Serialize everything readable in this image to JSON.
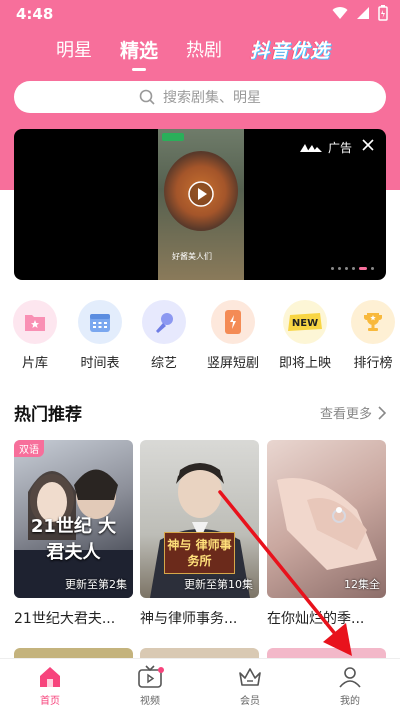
{
  "status": {
    "time": "4:48"
  },
  "top_tabs": [
    {
      "label": "明星"
    },
    {
      "label": "精选",
      "active": true
    },
    {
      "label": "热剧"
    }
  ],
  "promo_label": "抖音优选",
  "search": {
    "placeholder": "搜索剧集、明星"
  },
  "banner": {
    "ad_label": "广告",
    "thumb_caption": "好酱美人们"
  },
  "categories": [
    {
      "label": "片库",
      "icon": "film-library-icon",
      "color": "#f990b4"
    },
    {
      "label": "时间表",
      "icon": "calendar-icon",
      "color": "#7aa7ef"
    },
    {
      "label": "综艺",
      "icon": "microphone-icon",
      "color": "#8c98f1"
    },
    {
      "label": "竖屏短剧",
      "icon": "phone-icon",
      "color": "#f48b55"
    },
    {
      "label": "即将上映",
      "icon": "new-badge-icon",
      "color": "#f8d544"
    },
    {
      "label": "排行榜",
      "icon": "trophy-icon",
      "color": "#f8b93c"
    }
  ],
  "section": {
    "title": "热门推荐",
    "more_label": "查看更多"
  },
  "cards": [
    {
      "title": "21世纪大君夫...",
      "badge": "双语",
      "episode": "更新至第2集",
      "poster_text": "21世纪 大君夫人"
    },
    {
      "title": "神与律师事务...",
      "badge": "",
      "episode": "更新至第10集",
      "poster_text": "神与 律师事务所"
    },
    {
      "title": "在你灿烂的季...",
      "badge": "",
      "episode": "12集全",
      "poster_text": ""
    }
  ],
  "tabbar": [
    {
      "label": "首页",
      "icon": "home-icon",
      "active": true
    },
    {
      "label": "视频",
      "icon": "tv-icon"
    },
    {
      "label": "会员",
      "icon": "crown-icon"
    },
    {
      "label": "我的",
      "icon": "profile-icon"
    }
  ],
  "colors": {
    "accent": "#f76f9b",
    "active_tab": "#f7437c",
    "annotation_arrow": "#e8121c"
  }
}
